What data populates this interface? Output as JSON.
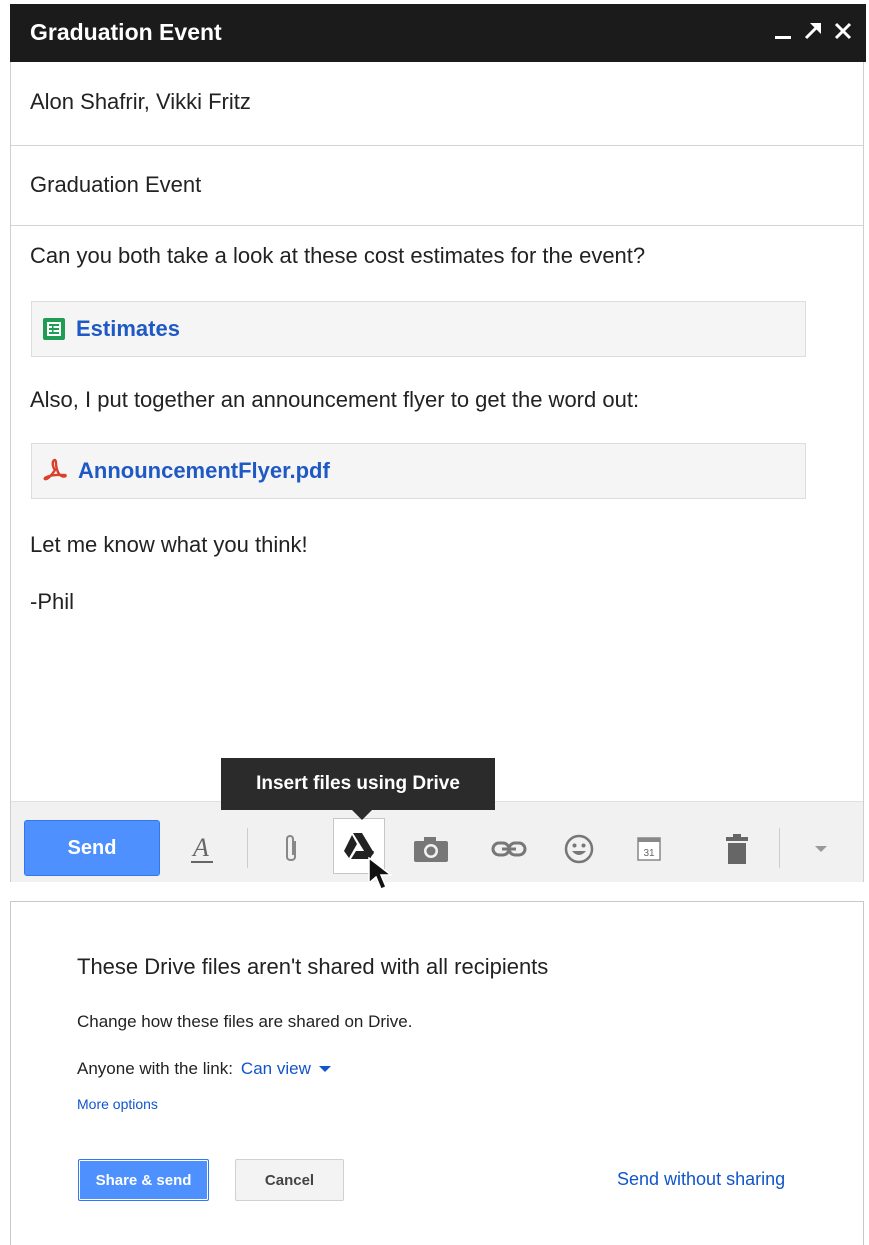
{
  "compose": {
    "title": "Graduation Event",
    "to": "Alon Shafrir, Vikki Fritz",
    "subject": "Graduation Event",
    "body": {
      "line1": "Can you both take a look at these cost estimates for the event?",
      "attachment1": {
        "label": "Estimates",
        "icon": "sheets-icon",
        "color": "#1f9d55"
      },
      "line2": "Also, I put together an announcement flyer to get the word out:",
      "attachment2": {
        "label": "AnnouncementFlyer.pdf",
        "icon": "pdf-icon",
        "color": "#d9412e"
      },
      "line3": "Let me know what you think!",
      "signature": "-Phil"
    },
    "tooltip": "Insert files using Drive",
    "toolbar": {
      "send_label": "Send",
      "calendar_day": "31"
    }
  },
  "dialog": {
    "title": "These Drive files aren't shared with all recipients",
    "description": "Change how these files are shared on Drive.",
    "link_label": "Anyone with the link:",
    "permission": "Can view",
    "more_options": "More options",
    "share_send": "Share & send",
    "cancel": "Cancel",
    "send_without": "Send without sharing"
  },
  "colors": {
    "accent": "#4d90fe",
    "link": "#1155cc",
    "titlebar": "#1b1b1b"
  }
}
